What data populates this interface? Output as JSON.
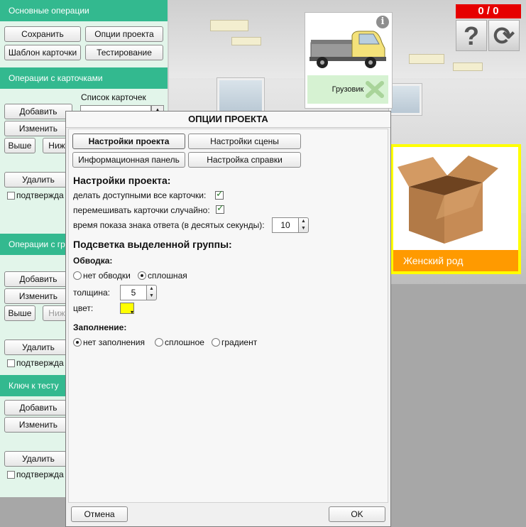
{
  "left_panel": {
    "basic_ops": {
      "header": "Основные операции",
      "save": "Сохранить",
      "project_options": "Опции проекта",
      "card_template": "Шаблон карточки",
      "testing": "Тестирование"
    },
    "card_ops": {
      "header": "Операции с карточками",
      "card_list_label": "Список карточек",
      "add": "Добавить",
      "edit": "Изменить",
      "up": "Выше",
      "down": "Ниж",
      "delete": "Удалить",
      "confirm": "подтвержда"
    },
    "group_ops": {
      "header": "Операции с гр",
      "add": "Добавить",
      "edit": "Изменить",
      "up": "Выше",
      "down": "Ниж",
      "delete": "Удалить",
      "confirm": "подтвержда"
    },
    "test_key": {
      "header": "Ключ к тесту",
      "add": "Добавить",
      "edit": "Изменить",
      "delete": "Удалить",
      "confirm": "подтвержда"
    }
  },
  "scene": {
    "score": "0 / 0",
    "help_icon": "question-icon",
    "reset_icon": "refresh-icon",
    "card_truck": {
      "label": "Грузовик"
    },
    "card_box": {
      "label": "Женский род"
    }
  },
  "dialog": {
    "title": "ОПЦИИ ПРОЕКТА",
    "tabs": [
      "Настройки проекта",
      "Настройки сцены",
      "Информационная панель",
      "Настройка справки"
    ],
    "project_settings": {
      "heading": "Настройки проекта:",
      "all_cards_available": "делать доступными все карточки:",
      "shuffle_cards": "перемешивать карточки случайно:",
      "answer_time": "время показа знака ответа (в десятых секунды):",
      "answer_time_value": "10"
    },
    "highlight": {
      "heading": "Подсветка выделенной группы:",
      "outline_heading": "Обводка:",
      "outline_none": "нет обводки",
      "outline_solid": "сплошная",
      "thickness_label": "толщина:",
      "thickness_value": "5",
      "color_label": "цвет:",
      "color_value": "#ffff00",
      "fill_heading": "Заполнение:",
      "fill_none": "нет заполнения",
      "fill_solid": "сплошное",
      "fill_gradient": "градиент"
    },
    "cancel": "Отмена",
    "ok": "OK"
  }
}
